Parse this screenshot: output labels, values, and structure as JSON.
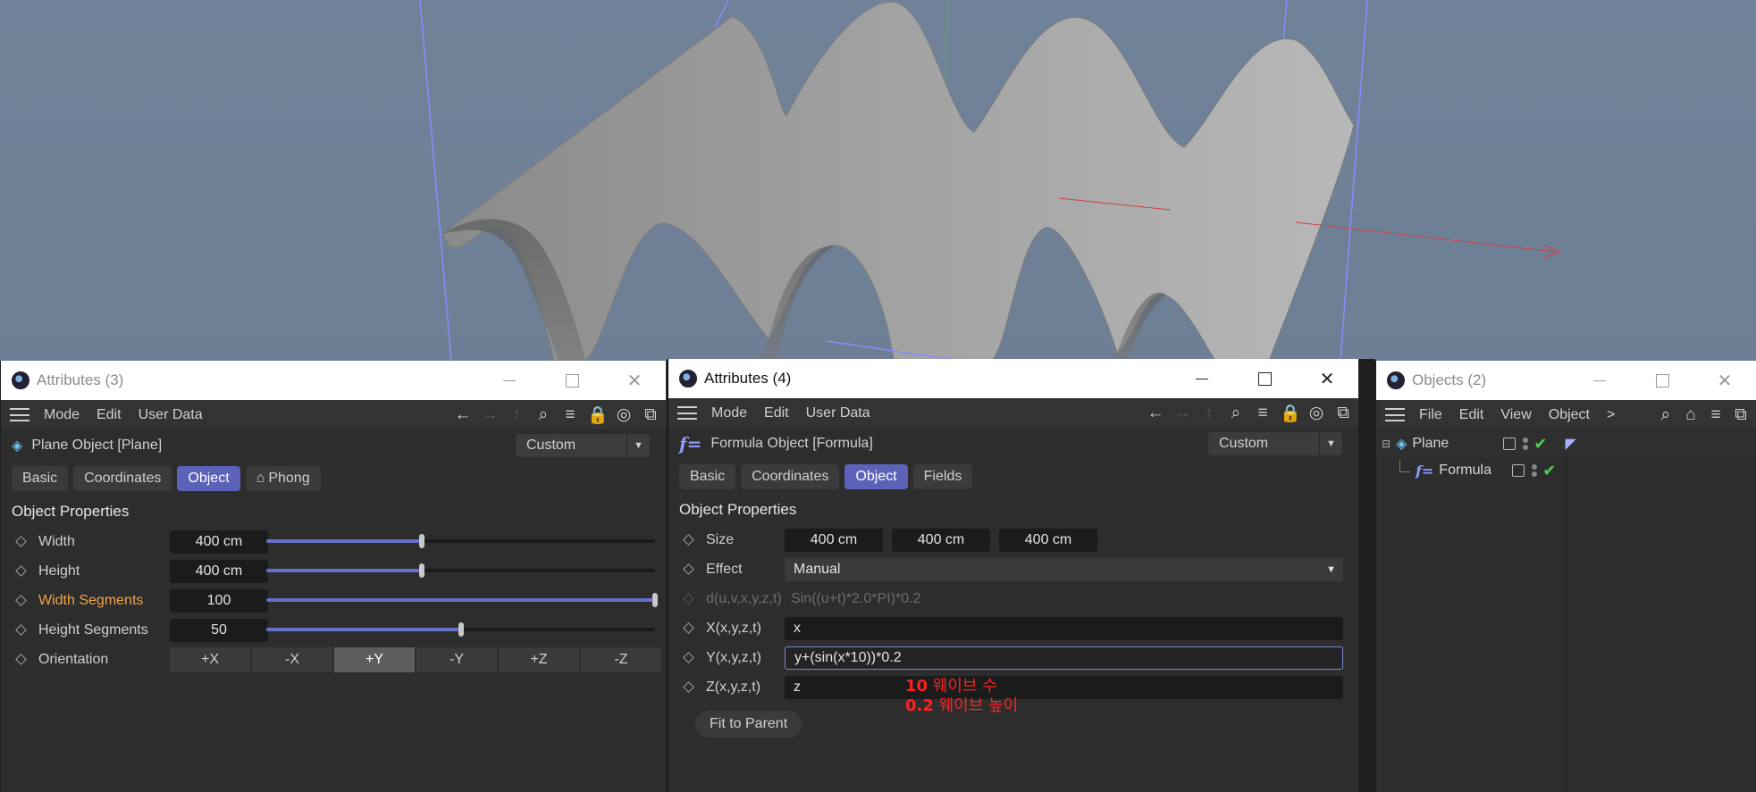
{
  "colors": {
    "accent": "#5b62b8",
    "highlight_label": "#f0a24a",
    "annotation": "#ff2020",
    "check": "#4ccd4c"
  },
  "left_panel": {
    "title": "Attributes (3)",
    "menu": [
      "Mode",
      "Edit",
      "User Data"
    ],
    "object_name": "Plane Object [Plane]",
    "layout_select": "Custom",
    "tabs": [
      "Basic",
      "Coordinates",
      "Object",
      "Phong"
    ],
    "active_tab": "Object",
    "section_title": "Object Properties",
    "props": [
      {
        "label": "Width",
        "value": "400 cm",
        "slider_fraction": 0.4
      },
      {
        "label": "Height",
        "value": "400 cm",
        "slider_fraction": 0.4
      },
      {
        "label": "Width Segments",
        "value": "100",
        "slider_fraction": 1.0
      },
      {
        "label": "Height Segments",
        "value": "50",
        "slider_fraction": 0.5
      }
    ],
    "orientation_label": "Orientation",
    "orientation_options": [
      "+X",
      "-X",
      "+Y",
      "-Y",
      "+Z",
      "-Z"
    ],
    "orientation_selected": "+Y"
  },
  "mid_panel": {
    "title": "Attributes (4)",
    "menu": [
      "Mode",
      "Edit",
      "User Data"
    ],
    "object_name": "Formula Object [Formula]",
    "layout_select": "Custom",
    "tabs": [
      "Basic",
      "Coordinates",
      "Object",
      "Fields"
    ],
    "active_tab": "Object",
    "section_title": "Object Properties",
    "size_label": "Size",
    "size_values": [
      "400 cm",
      "400 cm",
      "400 cm"
    ],
    "effect_label": "Effect",
    "effect_value": "Manual",
    "d_label": "d(u,v,x,y,z,t)",
    "d_value": "Sin((u+t)*2.0*PI)*0.2",
    "x_label": "X(x,y,z,t)",
    "x_value": "x",
    "y_label": "Y(x,y,z,t)",
    "y_value": "y+(sin(x*10))*0.2",
    "z_label": "Z(x,y,z,t)",
    "z_value": "z",
    "fit_button": "Fit to Parent",
    "annotation_line1_num": "10",
    "annotation_line1_text": "웨이브 수",
    "annotation_line2_num": "0.2",
    "annotation_line2_text": "웨이브 높이"
  },
  "right_panel": {
    "title": "Objects (2)",
    "menu": [
      "File",
      "Edit",
      "View",
      "Object"
    ],
    "more": ">",
    "tree": [
      {
        "name": "Plane",
        "icon": "plane-icon"
      },
      {
        "name": "Formula",
        "icon": "formula-icon"
      }
    ]
  }
}
